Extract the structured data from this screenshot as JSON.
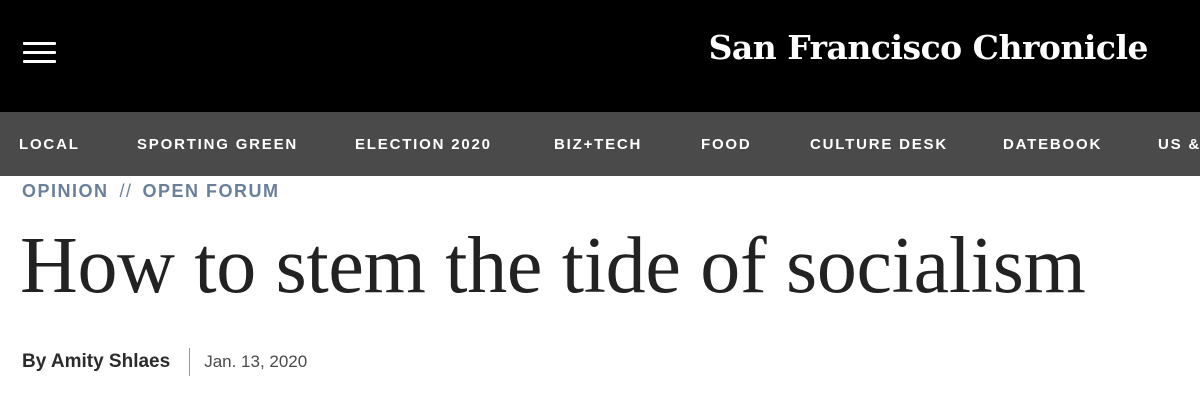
{
  "header": {
    "menu_icon": "hamburger-menu-icon",
    "logo_text": "San Francisco Chronicle"
  },
  "nav": {
    "items": [
      {
        "label": "LOCAL"
      },
      {
        "label": "SPORTING GREEN"
      },
      {
        "label": "ELECTION 2020"
      },
      {
        "label": "BIZ+TECH"
      },
      {
        "label": "FOOD"
      },
      {
        "label": "CULTURE DESK"
      },
      {
        "label": "DATEBOOK"
      },
      {
        "label": "US &"
      }
    ]
  },
  "article": {
    "section": "OPINION",
    "separator": "//",
    "subsection": "OPEN FORUM",
    "headline": "How to stem the tide of socialism",
    "byline": "By Amity Shlaes",
    "date": "Jan. 13, 2020"
  },
  "colors": {
    "topbar": "#000000",
    "navbar": "#4a4a4a",
    "kicker": "#6a7f99",
    "headline": "#222222"
  }
}
